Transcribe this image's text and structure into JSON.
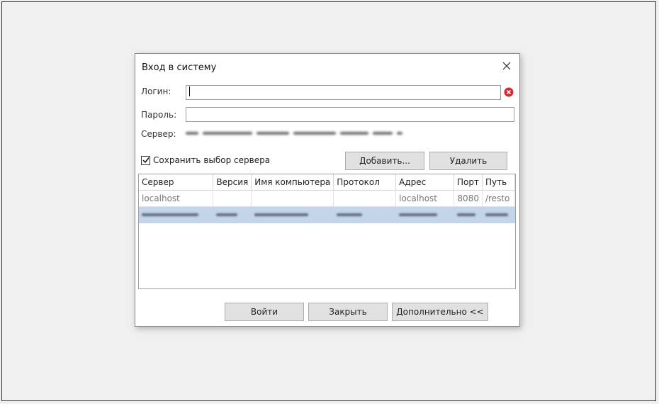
{
  "dialog": {
    "title": "Вход в систему",
    "login_label": "Логин:",
    "login_value": "",
    "password_label": "Пароль:",
    "password_value": "",
    "server_label": "Сервер:",
    "save_server_label": "Сохранить выбор сервера",
    "save_server_checked": true,
    "add_button": "Добавить...",
    "delete_button": "Удалить",
    "login_button": "Войти",
    "close_button": "Закрыть",
    "more_button": "Дополнительно <<"
  },
  "table": {
    "columns": [
      "Сервер",
      "Версия",
      "Имя компьютера",
      "Протокол",
      "Адрес",
      "Порт",
      "Путь"
    ],
    "rows": [
      {
        "server": "localhost",
        "version": "",
        "computer": "",
        "protocol": "",
        "address": "localhost",
        "port": "8080",
        "path": "/resto"
      }
    ]
  },
  "colors": {
    "selected_row": "#c5d5e9",
    "error_icon": "#d9272f",
    "background": "#f0f0f0"
  },
  "icons": [
    "close-icon",
    "error-clear-icon",
    "checkmark-icon"
  ]
}
